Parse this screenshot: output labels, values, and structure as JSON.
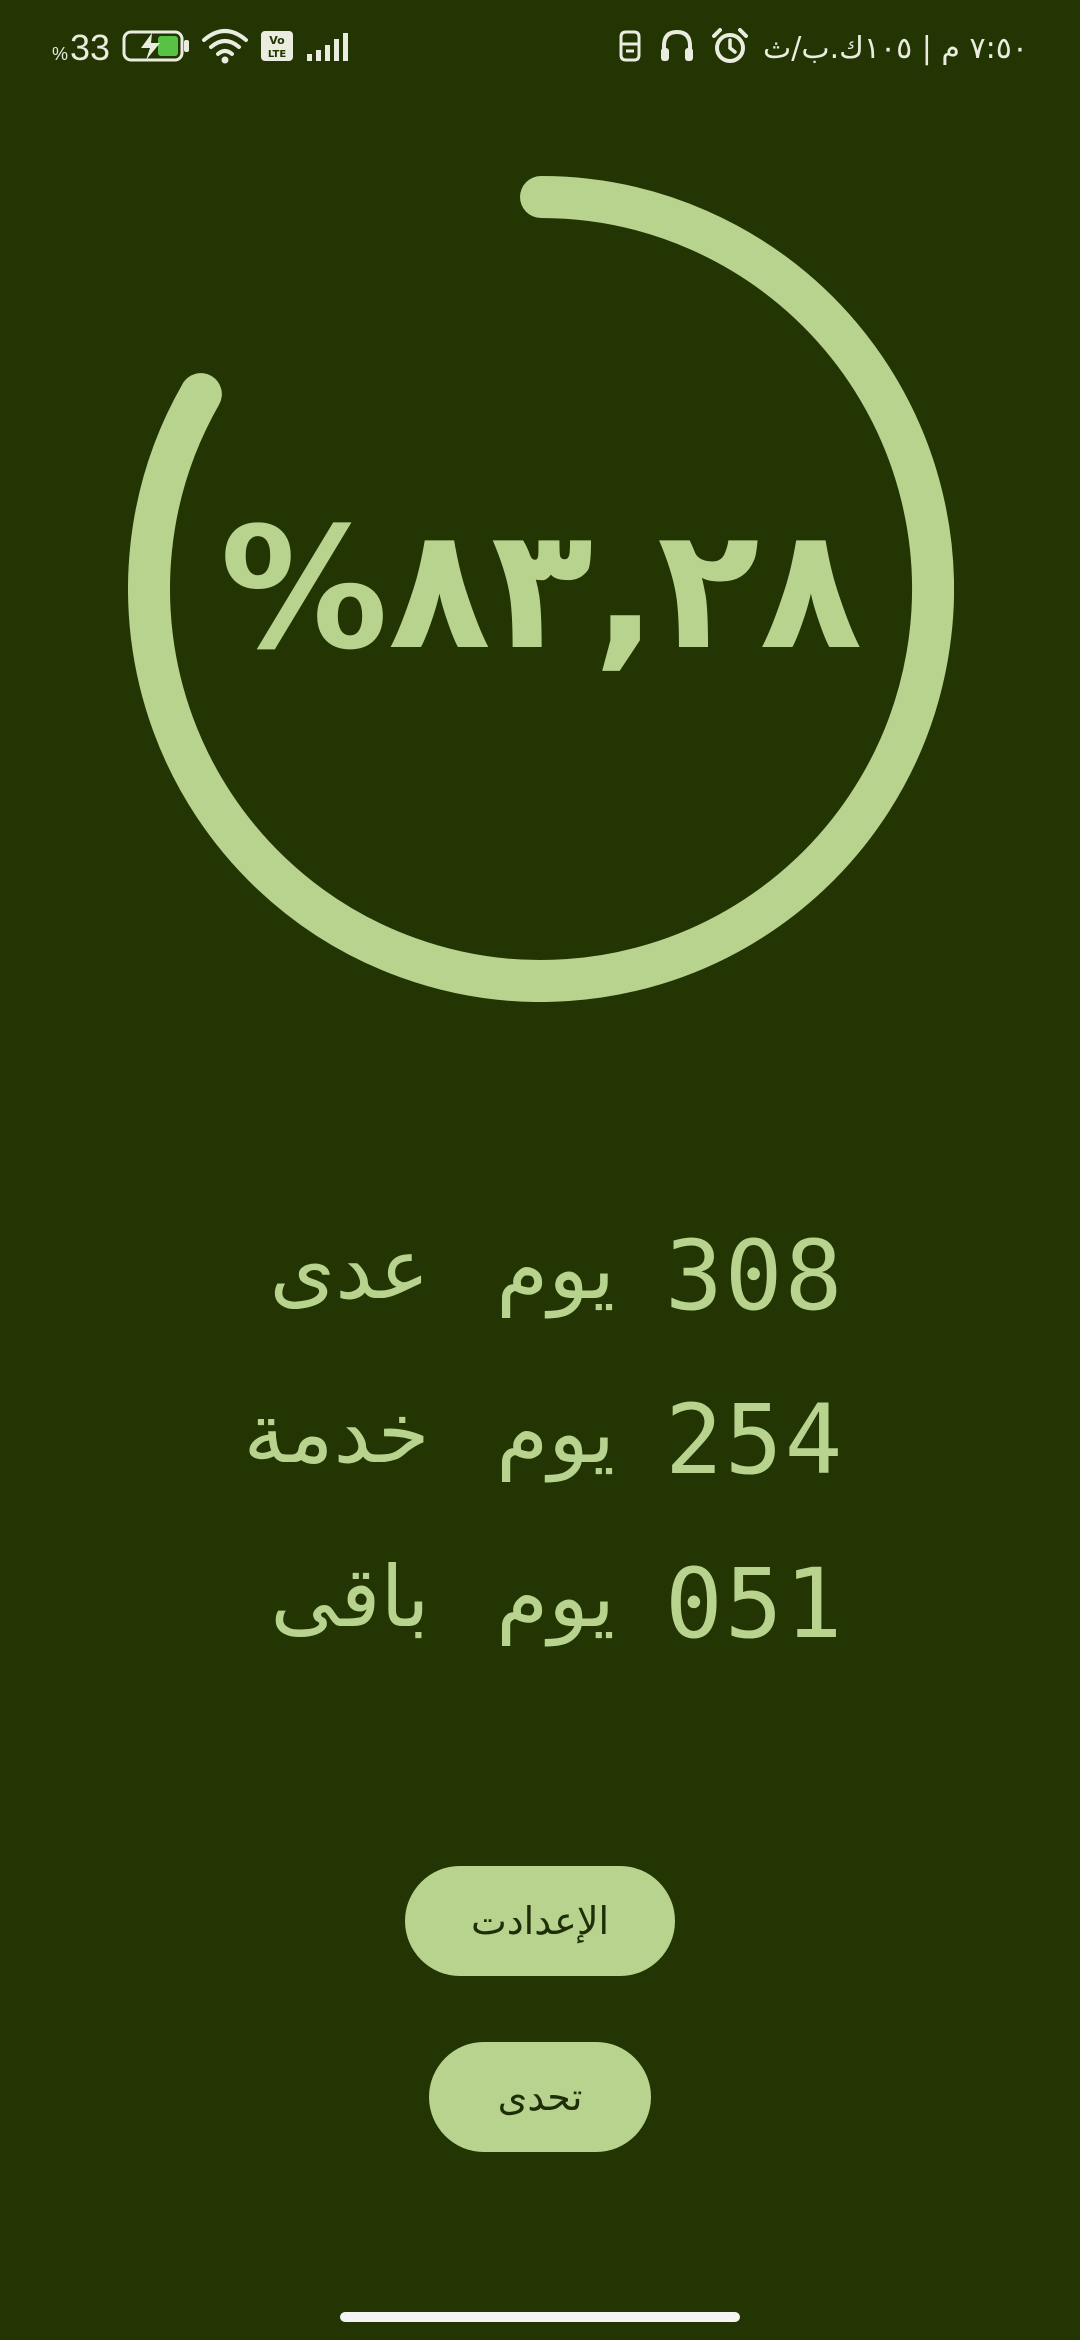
{
  "status_bar": {
    "battery_percent": "33",
    "battery_percent_sign": "%",
    "clock": "٧:٥٠ م | ١٠٥ك.ب/ث",
    "icons": [
      "battery-charging-icon",
      "wifi-icon",
      "volte-icon",
      "signal-icon",
      "sim-icon",
      "headphones-icon",
      "alarm-icon"
    ]
  },
  "progress": {
    "percent_label": "٨٣,٢٨%",
    "fraction": 0.8328,
    "ring_color": "#b7d38e",
    "background_color": "#223502"
  },
  "stats": {
    "rows": [
      {
        "number": "308",
        "label": "يوم عدى"
      },
      {
        "number": "254",
        "label": "يوم خدمة"
      },
      {
        "number": "051",
        "label": "يوم باقى"
      }
    ]
  },
  "buttons": {
    "settings_label": "الإعدادت",
    "challenge_label": "تحدى"
  }
}
